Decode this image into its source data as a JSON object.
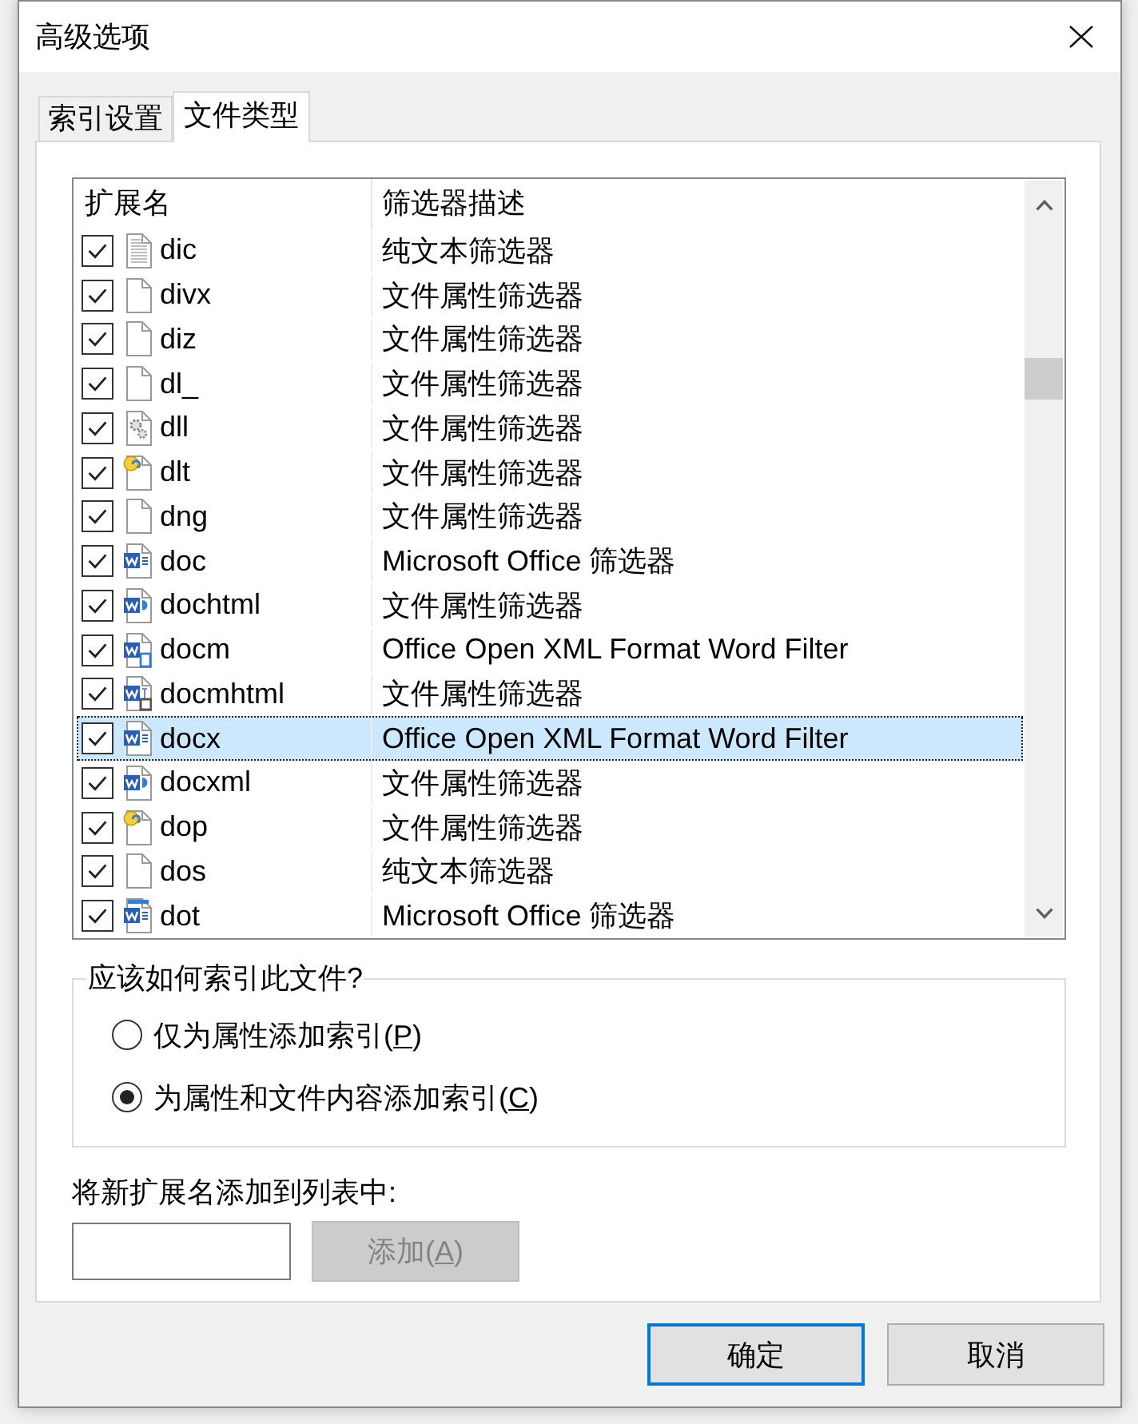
{
  "window": {
    "title": "高级选项"
  },
  "tabs": [
    {
      "label": "索引设置",
      "selected": false
    },
    {
      "label": "文件类型",
      "selected": true
    }
  ],
  "file_types": {
    "columns": [
      "扩展名",
      "筛选器描述"
    ],
    "rows": [
      {
        "ext": "dic",
        "description": "纯文本筛选器",
        "kind": "text",
        "checked": true,
        "selected": false
      },
      {
        "ext": "divx",
        "description": "文件属性筛选器",
        "kind": "blank",
        "checked": true,
        "selected": false
      },
      {
        "ext": "diz",
        "description": "文件属性筛选器",
        "kind": "blank",
        "checked": true,
        "selected": false
      },
      {
        "ext": "dl_",
        "description": "文件属性筛选器",
        "kind": "blank",
        "checked": true,
        "selected": false
      },
      {
        "ext": "dll",
        "description": "文件属性筛选器",
        "kind": "gear",
        "checked": true,
        "selected": false
      },
      {
        "ext": "dlt",
        "description": "文件属性筛选器",
        "kind": "script",
        "checked": true,
        "selected": false
      },
      {
        "ext": "dng",
        "description": "文件属性筛选器",
        "kind": "blank",
        "checked": true,
        "selected": false
      },
      {
        "ext": "doc",
        "description": "Microsoft Office 筛选器",
        "kind": "word",
        "checked": true,
        "selected": false
      },
      {
        "ext": "dochtml",
        "description": "文件属性筛选器",
        "kind": "wordweb",
        "checked": true,
        "selected": false
      },
      {
        "ext": "docm",
        "description": "Office Open XML Format Word Filter",
        "kind": "wordmacro",
        "checked": true,
        "selected": false
      },
      {
        "ext": "docmhtml",
        "description": "文件属性筛选器",
        "kind": "wordmhtml",
        "checked": true,
        "selected": false
      },
      {
        "ext": "docx",
        "description": "Office Open XML Format Word Filter",
        "kind": "word",
        "checked": true,
        "selected": true
      },
      {
        "ext": "docxml",
        "description": "文件属性筛选器",
        "kind": "wordweb",
        "checked": true,
        "selected": false
      },
      {
        "ext": "dop",
        "description": "文件属性筛选器",
        "kind": "script",
        "checked": true,
        "selected": false
      },
      {
        "ext": "dos",
        "description": "纯文本筛选器",
        "kind": "blank",
        "checked": true,
        "selected": false
      },
      {
        "ext": "dot",
        "description": "Microsoft Office 筛选器",
        "kind": "wordtemplate",
        "checked": true,
        "selected": false
      }
    ]
  },
  "index_group": {
    "title": "应该如何索引此文件?",
    "options": [
      {
        "label_parts": [
          "仅为属性添加索引(",
          "P",
          ")"
        ],
        "selected": false
      },
      {
        "label_parts": [
          "为属性和文件内容添加索引(",
          "C",
          ")"
        ],
        "selected": true
      }
    ]
  },
  "add_extension": {
    "label": "将新扩展名添加到列表中:",
    "button": {
      "label_parts": [
        "添加(",
        "A",
        ")"
      ],
      "disabled": true
    }
  },
  "buttons": [
    {
      "label": "确定",
      "default": true
    },
    {
      "label": "取消",
      "default": false
    }
  ]
}
